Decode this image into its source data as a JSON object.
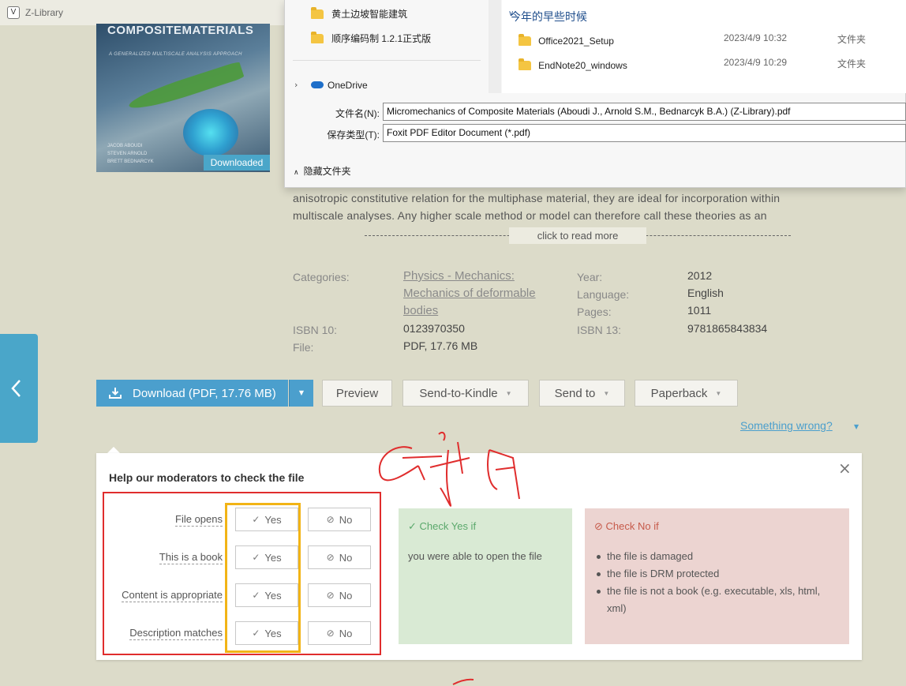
{
  "window": {
    "tab_icon": "V",
    "tab_title": "Z-Library"
  },
  "book": {
    "cover_title": "COMPOSITEMATERIALS",
    "cover_subtitle": "A GENERALIZED MULTISCALE ANALYSIS APPROACH",
    "cover_authors": [
      "JACOB ABOUDI",
      "STEVEN ARNOLD",
      "BRETT BEDNARCYK"
    ],
    "badge": "Downloaded"
  },
  "description": {
    "line1": "anisotropic constitutive relation for the multiphase material, they are ideal for incorporation within",
    "line2": "multiscale analyses. Any higher scale method or model can therefore call these theories as an",
    "read_more": "click to read more"
  },
  "meta": {
    "categories_label": "Categories:",
    "categories_link1": "Physics - Mechanics:",
    "categories_link2": "Mechanics of deformable",
    "categories_link3": "bodies",
    "isbn10_label": "ISBN 10:",
    "isbn10": "0123970350",
    "file_label": "File:",
    "file": "PDF, 17.76 MB",
    "year_label": "Year:",
    "year": "2012",
    "language_label": "Language:",
    "language": "English",
    "pages_label": "Pages:",
    "pages": "1011",
    "isbn13_label": "ISBN 13:",
    "isbn13": "9781865843834"
  },
  "actions": {
    "download": "Download (PDF, 17.76 MB)",
    "preview": "Preview",
    "send_kindle": "Send-to-Kindle",
    "send_to": "Send to",
    "paperback": "Paperback",
    "something_wrong": "Something wrong?"
  },
  "moderation": {
    "title": "Help our moderators to check the file",
    "close": "×",
    "questions": [
      {
        "label": "File opens",
        "yes": "Yes",
        "no": "No"
      },
      {
        "label": "This is a book",
        "yes": "Yes",
        "no": "No"
      },
      {
        "label": "Content is appropriate",
        "yes": "Yes",
        "no": "No"
      },
      {
        "label": "Description matches",
        "yes": "Yes",
        "no": "No"
      }
    ],
    "yes_head": "Check Yes if",
    "yes_text": "you were able to open the file",
    "no_head": "Check No if",
    "no_items": [
      "the file is damaged",
      "the file is DRM protected",
      "the file is not a book (e.g. executable, xls, html, xml)"
    ]
  },
  "dialog": {
    "nav_folders": [
      "黄土边坡智能建筑",
      "顺序编码制 1.2.1正式版"
    ],
    "onedrive": "OneDrive",
    "group_header": "今年的早些时候",
    "files": [
      {
        "name": "Office2021_Setup",
        "date": "2023/4/9 10:32",
        "type": "文件夹"
      },
      {
        "name": "EndNote20_windows",
        "date": "2023/4/9 10:29",
        "type": "文件夹"
      }
    ],
    "filename_label": "文件名(N):",
    "filename_value": "Micromechanics of Composite Materials (Aboudi J., Arnold S.M., Bednarcyk B.A.) (Z-Library).pdf",
    "filetype_label": "保存类型(T):",
    "filetype_value": "Foxit PDF Editor Document (*.pdf)",
    "hide_folders": "隐藏文件夹"
  },
  "colors": {
    "accent": "#4b9fcd",
    "annotation_red": "#e02d2d",
    "annotation_yellow": "#f2b416"
  }
}
